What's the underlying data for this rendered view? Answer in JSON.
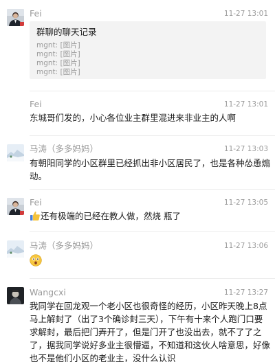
{
  "messages": [
    {
      "sender": "Fei",
      "time": "11-27 13:01",
      "avatar_icon": "man-in-suit-avatar",
      "card": {
        "title": "群聊的聊天记录",
        "lines": [
          "mgnt: [图片]",
          "mgnt: [图片]",
          "mgnt: [图片]",
          "mgnt: [图片]"
        ]
      }
    },
    {
      "sender": "Fei",
      "time": "11-27 13:01",
      "text": "东城哥们发的，小心各位业主群里混进来非业主的人啊"
    },
    {
      "sender": "马涛（多多妈妈）",
      "time": "11-27 13:03",
      "avatar_icon": "winter-landscape-avatar",
      "text": "有朝阳同学的小区群里已经抓出非小区居民了，也是各种怂恿煽动。"
    },
    {
      "sender": "Fei",
      "time": "11-27 13:05",
      "avatar_icon": "man-in-suit-avatar",
      "emoji": "thumbs-up-icon",
      "text": "还有极端的已经在教人做，然烧 瓶了"
    },
    {
      "sender": "马涛（多多妈妈）",
      "time": "11-27 13:06",
      "avatar_icon": "winter-landscape-avatar",
      "emoji": "astonished-face-icon"
    },
    {
      "sender": "Wangcxi",
      "time": "11-27 13:27",
      "avatar_icon": "dark-portrait-avatar",
      "text": "我同学在回龙观一个老小区也很奇怪的经历，小区昨天晚上8点马上解封了（出了3个确诊封三天），下午有十来个人跑门口要求解封，最后把门弄开了，但是门开了也没出去，就不了了之了，据我同学说好多业主很懵逼，不知道和这伙人啥意思，好像也不是他们小区的老业主，没什么认识"
    }
  ],
  "colors": {
    "meta_text": "#9a9a9a",
    "card_bg": "#f3f3f3",
    "separator": "#ececec"
  }
}
